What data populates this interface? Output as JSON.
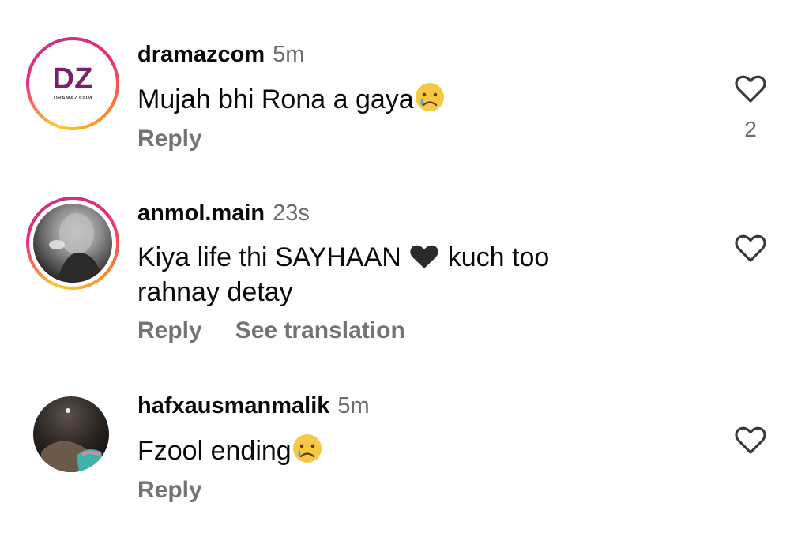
{
  "comments": [
    {
      "username": "dramazcom",
      "time": "5m",
      "text": "Mujah bhi Rona a gaya",
      "emoji": "crying-face",
      "actions": {
        "reply": "Reply"
      },
      "likes": "2",
      "avatar": {
        "logo_text": "DZ",
        "logo_caption": "DRAMAZ.COM",
        "has_story_ring": true
      }
    },
    {
      "username": "anmol.main",
      "time": "23s",
      "text_line1_part1": "Kiya life thi SAYHAAN",
      "emoji": "black-heart",
      "text_line1_part2": "kuch too",
      "text_line2": "rahnay detay",
      "actions": {
        "reply": "Reply",
        "translate": "See translation"
      },
      "avatar": {
        "has_story_ring": true
      }
    },
    {
      "username": "hafxausmanmalik",
      "time": "5m",
      "text": "Fzool ending",
      "emoji": "crying-face",
      "actions": {
        "reply": "Reply"
      },
      "avatar": {
        "has_story_ring": false
      }
    }
  ],
  "colors": {
    "username": "#0a0a0a",
    "meta": "#737373",
    "logo_purple": "#8a1c7c",
    "logo_magenta": "#c2185b"
  }
}
